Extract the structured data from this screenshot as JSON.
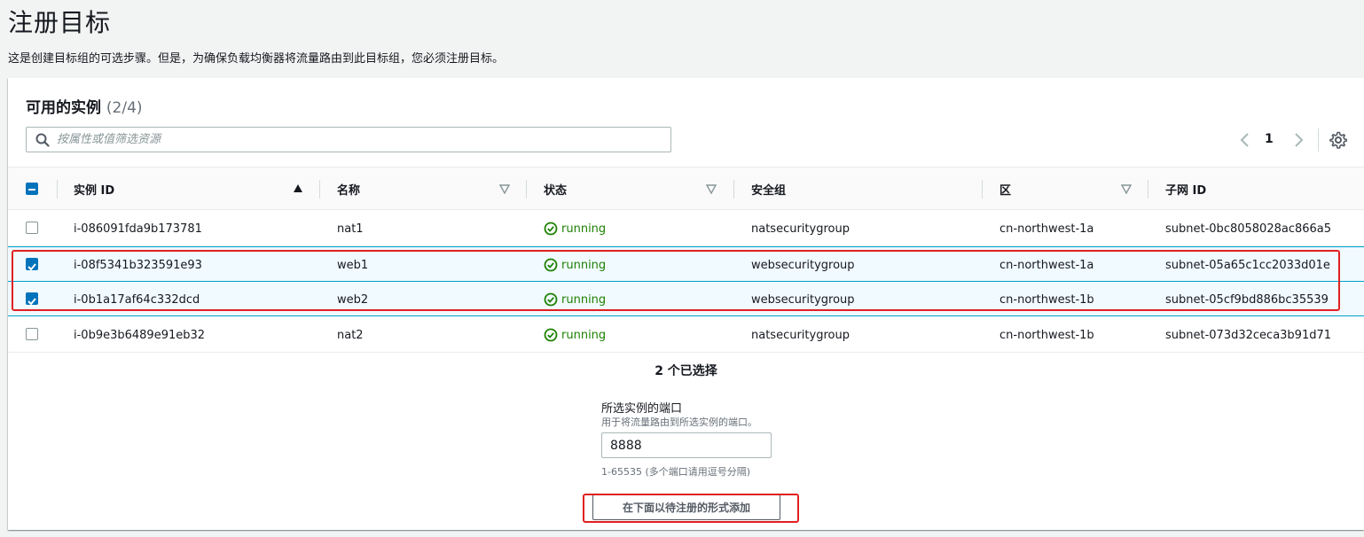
{
  "page": {
    "title": "注册目标",
    "description": "这是创建目标组的可选步骤。但是，为确保负载均衡器将流量路由到此目标组，您必须注册目标。"
  },
  "panel": {
    "title": "可用的实例",
    "count": "(2/4)",
    "search_placeholder": "按属性或值筛选资源",
    "page_number": "1"
  },
  "table": {
    "columns": [
      "实例 ID",
      "名称",
      "状态",
      "安全组",
      "区",
      "子网 ID"
    ],
    "rows": [
      {
        "id": "i-086091fda9b173781",
        "name": "nat1",
        "status": "running",
        "sg": "natsecuritygroup",
        "zone": "cn-northwest-1a",
        "subnet": "subnet-0bc8058028ac866a5",
        "checked": false
      },
      {
        "id": "i-08f5341b323591e93",
        "name": "web1",
        "status": "running",
        "sg": "websecuritygroup",
        "zone": "cn-northwest-1a",
        "subnet": "subnet-05a65c1cc2033d01e",
        "checked": true
      },
      {
        "id": "i-0b1a17af64c332dcd",
        "name": "web2",
        "status": "running",
        "sg": "websecuritygroup",
        "zone": "cn-northwest-1b",
        "subnet": "subnet-05cf9bd886bc35539",
        "checked": true
      },
      {
        "id": "i-0b9e3b6489e91eb32",
        "name": "nat2",
        "status": "running",
        "sg": "natsecuritygroup",
        "zone": "cn-northwest-1b",
        "subnet": "subnet-073d32ceca3b91d71",
        "checked": false
      }
    ]
  },
  "footer": {
    "selected_summary": "2 个已选择",
    "port_label": "所选实例的端口",
    "port_desc": "用于将流量路由到所选实例的端口。",
    "port_value": "8888",
    "port_hint": "1-65535 (多个端口请用逗号分隔)",
    "add_button": "在下面以待注册的形式添加"
  },
  "colors": {
    "accent": "#0073bb",
    "running": "#1d8102",
    "highlight": "#e02020",
    "selected_row": "#f1faff"
  }
}
